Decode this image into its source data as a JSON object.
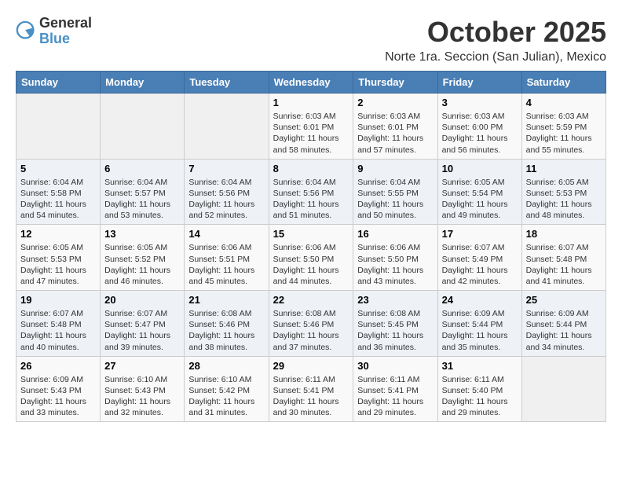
{
  "header": {
    "logo_general": "General",
    "logo_blue": "Blue",
    "month": "October 2025",
    "location": "Norte 1ra. Seccion (San Julian), Mexico"
  },
  "weekdays": [
    "Sunday",
    "Monday",
    "Tuesday",
    "Wednesday",
    "Thursday",
    "Friday",
    "Saturday"
  ],
  "weeks": [
    [
      {
        "day": "",
        "info": ""
      },
      {
        "day": "",
        "info": ""
      },
      {
        "day": "",
        "info": ""
      },
      {
        "day": "1",
        "info": "Sunrise: 6:03 AM\nSunset: 6:01 PM\nDaylight: 11 hours and 58 minutes."
      },
      {
        "day": "2",
        "info": "Sunrise: 6:03 AM\nSunset: 6:01 PM\nDaylight: 11 hours and 57 minutes."
      },
      {
        "day": "3",
        "info": "Sunrise: 6:03 AM\nSunset: 6:00 PM\nDaylight: 11 hours and 56 minutes."
      },
      {
        "day": "4",
        "info": "Sunrise: 6:03 AM\nSunset: 5:59 PM\nDaylight: 11 hours and 55 minutes."
      }
    ],
    [
      {
        "day": "5",
        "info": "Sunrise: 6:04 AM\nSunset: 5:58 PM\nDaylight: 11 hours and 54 minutes."
      },
      {
        "day": "6",
        "info": "Sunrise: 6:04 AM\nSunset: 5:57 PM\nDaylight: 11 hours and 53 minutes."
      },
      {
        "day": "7",
        "info": "Sunrise: 6:04 AM\nSunset: 5:56 PM\nDaylight: 11 hours and 52 minutes."
      },
      {
        "day": "8",
        "info": "Sunrise: 6:04 AM\nSunset: 5:56 PM\nDaylight: 11 hours and 51 minutes."
      },
      {
        "day": "9",
        "info": "Sunrise: 6:04 AM\nSunset: 5:55 PM\nDaylight: 11 hours and 50 minutes."
      },
      {
        "day": "10",
        "info": "Sunrise: 6:05 AM\nSunset: 5:54 PM\nDaylight: 11 hours and 49 minutes."
      },
      {
        "day": "11",
        "info": "Sunrise: 6:05 AM\nSunset: 5:53 PM\nDaylight: 11 hours and 48 minutes."
      }
    ],
    [
      {
        "day": "12",
        "info": "Sunrise: 6:05 AM\nSunset: 5:53 PM\nDaylight: 11 hours and 47 minutes."
      },
      {
        "day": "13",
        "info": "Sunrise: 6:05 AM\nSunset: 5:52 PM\nDaylight: 11 hours and 46 minutes."
      },
      {
        "day": "14",
        "info": "Sunrise: 6:06 AM\nSunset: 5:51 PM\nDaylight: 11 hours and 45 minutes."
      },
      {
        "day": "15",
        "info": "Sunrise: 6:06 AM\nSunset: 5:50 PM\nDaylight: 11 hours and 44 minutes."
      },
      {
        "day": "16",
        "info": "Sunrise: 6:06 AM\nSunset: 5:50 PM\nDaylight: 11 hours and 43 minutes."
      },
      {
        "day": "17",
        "info": "Sunrise: 6:07 AM\nSunset: 5:49 PM\nDaylight: 11 hours and 42 minutes."
      },
      {
        "day": "18",
        "info": "Sunrise: 6:07 AM\nSunset: 5:48 PM\nDaylight: 11 hours and 41 minutes."
      }
    ],
    [
      {
        "day": "19",
        "info": "Sunrise: 6:07 AM\nSunset: 5:48 PM\nDaylight: 11 hours and 40 minutes."
      },
      {
        "day": "20",
        "info": "Sunrise: 6:07 AM\nSunset: 5:47 PM\nDaylight: 11 hours and 39 minutes."
      },
      {
        "day": "21",
        "info": "Sunrise: 6:08 AM\nSunset: 5:46 PM\nDaylight: 11 hours and 38 minutes."
      },
      {
        "day": "22",
        "info": "Sunrise: 6:08 AM\nSunset: 5:46 PM\nDaylight: 11 hours and 37 minutes."
      },
      {
        "day": "23",
        "info": "Sunrise: 6:08 AM\nSunset: 5:45 PM\nDaylight: 11 hours and 36 minutes."
      },
      {
        "day": "24",
        "info": "Sunrise: 6:09 AM\nSunset: 5:44 PM\nDaylight: 11 hours and 35 minutes."
      },
      {
        "day": "25",
        "info": "Sunrise: 6:09 AM\nSunset: 5:44 PM\nDaylight: 11 hours and 34 minutes."
      }
    ],
    [
      {
        "day": "26",
        "info": "Sunrise: 6:09 AM\nSunset: 5:43 PM\nDaylight: 11 hours and 33 minutes."
      },
      {
        "day": "27",
        "info": "Sunrise: 6:10 AM\nSunset: 5:43 PM\nDaylight: 11 hours and 32 minutes."
      },
      {
        "day": "28",
        "info": "Sunrise: 6:10 AM\nSunset: 5:42 PM\nDaylight: 11 hours and 31 minutes."
      },
      {
        "day": "29",
        "info": "Sunrise: 6:11 AM\nSunset: 5:41 PM\nDaylight: 11 hours and 30 minutes."
      },
      {
        "day": "30",
        "info": "Sunrise: 6:11 AM\nSunset: 5:41 PM\nDaylight: 11 hours and 29 minutes."
      },
      {
        "day": "31",
        "info": "Sunrise: 6:11 AM\nSunset: 5:40 PM\nDaylight: 11 hours and 29 minutes."
      },
      {
        "day": "",
        "info": ""
      }
    ]
  ]
}
